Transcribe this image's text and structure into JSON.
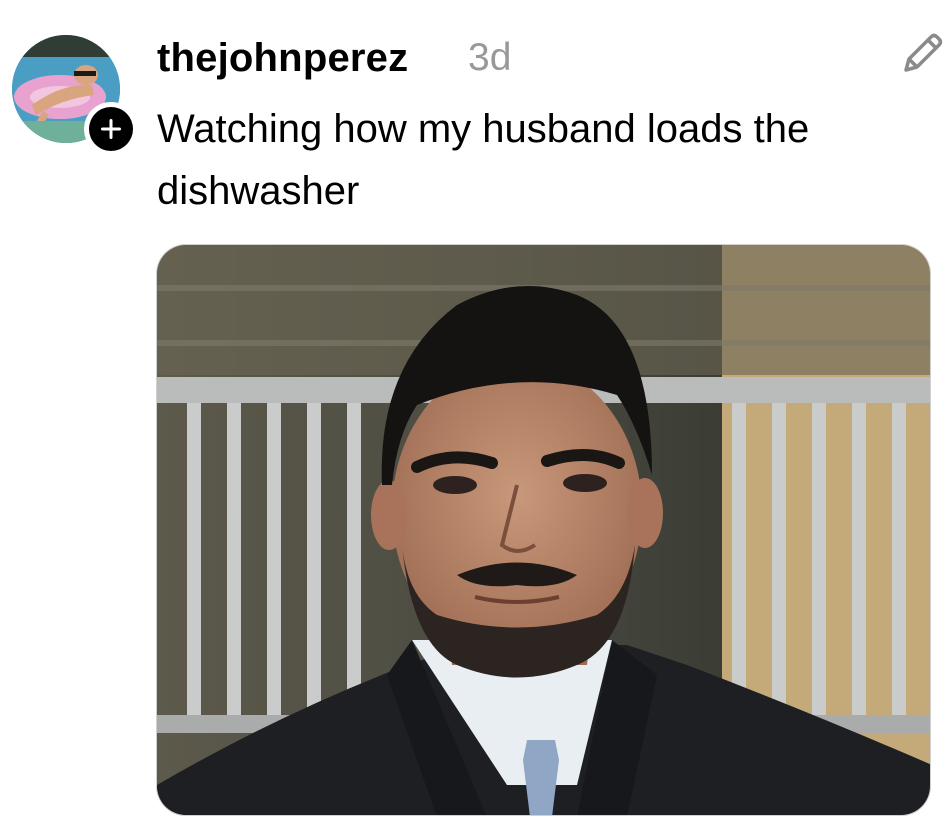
{
  "post": {
    "username": "thejohnperez",
    "timestamp": "3d",
    "caption": "Watching how my husband loads the dishwasher",
    "avatar_icon": "profile-photo-pool-float",
    "follow_icon": "plus-icon",
    "edit_icon": "pencil-icon",
    "media_description_icon": "photo-man-in-suit"
  },
  "colors": {
    "text_primary": "#000000",
    "text_secondary": "#999999",
    "background": "#ffffff"
  }
}
